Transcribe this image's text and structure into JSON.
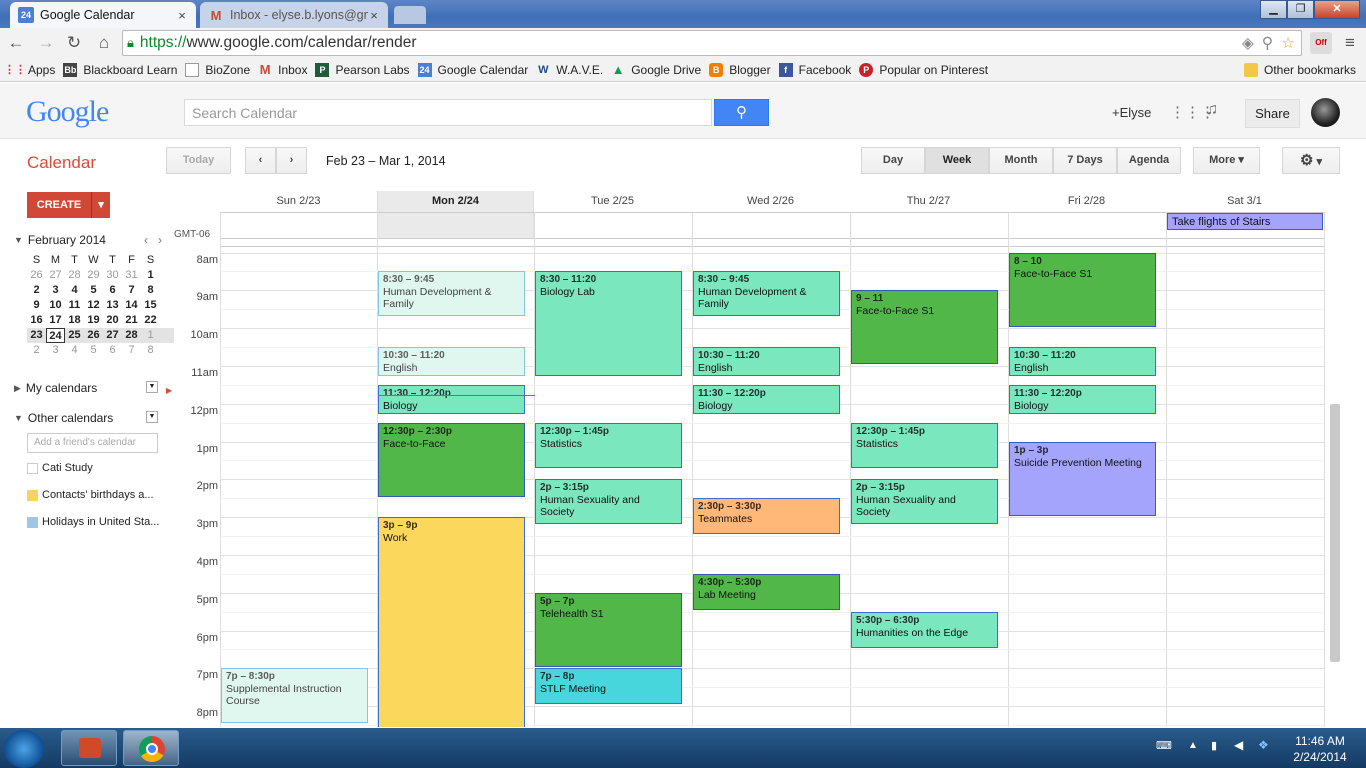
{
  "browser": {
    "tabs": [
      {
        "label": "Google Calendar",
        "icon": "calendar-icon"
      },
      {
        "label": "Inbox - elyse.b.lyons@gm",
        "icon": "gmail-icon"
      }
    ],
    "url_scheme": "https://",
    "url_rest": "www.google.com/calendar/render",
    "bookmarks": [
      "Apps",
      "Blackboard Learn",
      "BioZone",
      "Inbox",
      "Pearson Labs",
      "Google Calendar",
      "W.A.V.E.",
      "Google Drive",
      "Blogger",
      "Facebook",
      "Popular on Pinterest"
    ],
    "other_bookmarks": "Other bookmarks"
  },
  "header": {
    "logo": "Google",
    "search_placeholder": "Search Calendar",
    "user": "+Elyse",
    "share": "Share"
  },
  "calbar": {
    "title": "Calendar",
    "today": "Today",
    "date_range": "Feb 23 – Mar 1, 2014",
    "views": [
      "Day",
      "Week",
      "Month",
      "7 Days",
      "Agenda"
    ],
    "active_view": "Week",
    "more": "More"
  },
  "sidebar": {
    "create": "CREATE",
    "mini_month": "February 2014",
    "weekday_letters": [
      "S",
      "M",
      "T",
      "W",
      "T",
      "F",
      "S"
    ],
    "weeks": [
      [
        "26",
        "27",
        "28",
        "29",
        "30",
        "31",
        "1"
      ],
      [
        "2",
        "3",
        "4",
        "5",
        "6",
        "7",
        "8"
      ],
      [
        "9",
        "10",
        "11",
        "12",
        "13",
        "14",
        "15"
      ],
      [
        "16",
        "17",
        "18",
        "19",
        "20",
        "21",
        "22"
      ],
      [
        "23",
        "24",
        "25",
        "26",
        "27",
        "28",
        "1"
      ],
      [
        "2",
        "3",
        "4",
        "5",
        "6",
        "7",
        "8"
      ]
    ],
    "my_calendars": "My calendars",
    "other_calendars": "Other calendars",
    "add_friend": "Add a friend's calendar",
    "other_list": [
      {
        "label": "Cati Study",
        "color": "#ffffff"
      },
      {
        "label": "Contacts' birthdays a...",
        "color": "#fad165"
      },
      {
        "label": "Holidays in United Sta...",
        "color": "#9fc6e7"
      }
    ]
  },
  "week": {
    "days": [
      "Sun 2/23",
      "Mon 2/24",
      "Tue 2/25",
      "Wed 2/26",
      "Thu 2/27",
      "Fri 2/28",
      "Sat 3/1"
    ],
    "timezone": "GMT-06",
    "hours": [
      "8am",
      "9am",
      "10am",
      "11am",
      "12pm",
      "1pm",
      "2pm",
      "3pm",
      "4pm",
      "5pm",
      "6pm",
      "7pm",
      "8pm"
    ],
    "allday": [
      {
        "day": 6,
        "title": "Take flights of Stairs"
      }
    ],
    "events": [
      {
        "day": 1,
        "time": "8:30 – 9:45",
        "title": "Human Development & Family",
        "start": 8.5,
        "end": 9.75,
        "style": "lt"
      },
      {
        "day": 1,
        "time": "10:30 – 11:20",
        "title": "English",
        "start": 10.5,
        "end": 11.33,
        "style": "lt"
      },
      {
        "day": 1,
        "time": "11:30 – 12:20p",
        "title": "Biology",
        "start": 11.5,
        "end": 12.33,
        "style": "tq"
      },
      {
        "day": 1,
        "time": "12:30p – 2:30p",
        "title": "Face-to-Face",
        "start": 12.5,
        "end": 14.5,
        "style": "gr"
      },
      {
        "day": 1,
        "time": "3p – 9p",
        "title": "Work",
        "start": 15,
        "end": 21,
        "style": "yl"
      },
      {
        "day": 2,
        "time": "8:30 – 11:20",
        "title": "Biology Lab",
        "start": 8.5,
        "end": 11.33,
        "style": "tq"
      },
      {
        "day": 2,
        "time": "12:30p – 1:45p",
        "title": "Statistics",
        "start": 12.5,
        "end": 13.75,
        "style": "tq"
      },
      {
        "day": 2,
        "time": "2p – 3:15p",
        "title": "Human Sexuality and Society",
        "start": 14,
        "end": 15.25,
        "style": "tq"
      },
      {
        "day": 2,
        "time": "5p – 7p",
        "title": "Telehealth S1",
        "start": 17,
        "end": 19,
        "style": "gr"
      },
      {
        "day": 2,
        "time": "7p – 8p",
        "title": "STLF Meeting",
        "start": 19,
        "end": 20,
        "style": "cy"
      },
      {
        "day": 3,
        "time": "8:30 – 9:45",
        "title": "Human Development & Family",
        "start": 8.5,
        "end": 9.75,
        "style": "tq"
      },
      {
        "day": 3,
        "time": "10:30 – 11:20",
        "title": "English",
        "start": 10.5,
        "end": 11.33,
        "style": "tq"
      },
      {
        "day": 3,
        "time": "11:30 – 12:20p",
        "title": "Biology",
        "start": 11.5,
        "end": 12.33,
        "style": "tq"
      },
      {
        "day": 3,
        "time": "2:30p – 3:30p",
        "title": "Teammates",
        "start": 14.5,
        "end": 15.5,
        "style": "or"
      },
      {
        "day": 3,
        "time": "4:30p – 5:30p",
        "title": "Lab Meeting",
        "start": 16.5,
        "end": 17.5,
        "style": "gr"
      },
      {
        "day": 4,
        "time": "9 – 11",
        "title": "Face-to-Face S1",
        "start": 9,
        "end": 11,
        "style": "gr"
      },
      {
        "day": 4,
        "time": "12:30p – 1:45p",
        "title": "Statistics",
        "start": 12.5,
        "end": 13.75,
        "style": "tq"
      },
      {
        "day": 4,
        "time": "2p – 3:15p",
        "title": "Human Sexuality and Society",
        "start": 14,
        "end": 15.25,
        "style": "tq"
      },
      {
        "day": 4,
        "time": "5:30p – 6:30p",
        "title": "Humanities on the Edge",
        "start": 17.5,
        "end": 18.5,
        "style": "tq"
      },
      {
        "day": 5,
        "time": "8 – 10",
        "title": "Face-to-Face S1",
        "start": 8,
        "end": 10,
        "style": "gr"
      },
      {
        "day": 5,
        "time": "10:30 – 11:20",
        "title": "English",
        "start": 10.5,
        "end": 11.33,
        "style": "tq"
      },
      {
        "day": 5,
        "time": "11:30 – 12:20p",
        "title": "Biology",
        "start": 11.5,
        "end": 12.33,
        "style": "tq"
      },
      {
        "day": 5,
        "time": "1p – 3p",
        "title": "Suicide Prevention Meeting",
        "start": 13,
        "end": 15,
        "style": "pu"
      },
      {
        "day": 0,
        "time": "7p – 8:30p",
        "title": "Supplemental Instruction Course",
        "start": 19,
        "end": 20.5,
        "style": "lt"
      }
    ]
  },
  "taskbar": {
    "time": "11:46 AM",
    "date": "2/24/2014"
  }
}
